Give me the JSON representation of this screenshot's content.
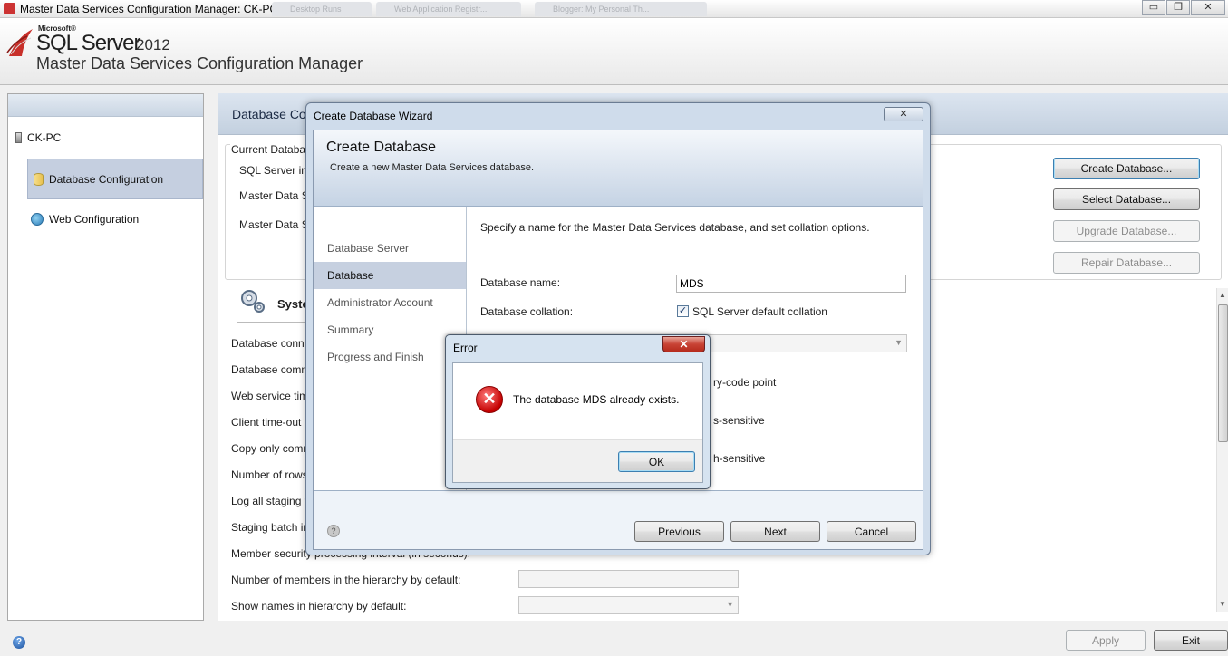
{
  "window": {
    "title": "Master Data Services Configuration Manager: CK-PC",
    "background_tabs": [
      "Desktop Runs",
      "Web Application Registr...",
      "Blogger: My Personal Th..."
    ],
    "controls": {
      "minimize": "▭",
      "restore": "❐",
      "close": "✕"
    }
  },
  "banner": {
    "microsoft": "Microsoft®",
    "sql_server": "SQL Server",
    "year": "2012",
    "product": "Master Data Services Configuration Manager"
  },
  "sidebar": {
    "server": "CK-PC",
    "items": [
      {
        "label": "Database Configuration",
        "icon": "database-icon",
        "selected": true
      },
      {
        "label": "Web Configuration",
        "icon": "globe-icon",
        "selected": false
      }
    ]
  },
  "main": {
    "header_title": "Database Configuration",
    "group_label": "Current Database",
    "group_rows": [
      "SQL Server instance:",
      "Master Data Services database:",
      "Master Data Services version:"
    ],
    "buttons": {
      "create": "Create Database...",
      "select": "Select Database...",
      "upgrade": "Upgrade Database...",
      "repair": "Repair Database..."
    },
    "system_settings_title": "System Settings",
    "settings_rows": [
      "Database connection time-out (in seconds):",
      "Database command time-out (in seconds):",
      "Web service time-out (in seconds):",
      "Client time-out (in seconds):",
      "Copy only committed versions:",
      "Number of rows per batch:",
      "Log all staging transactions:",
      "Staging batch interval (in seconds):",
      "Member security processing interval (in seconds):",
      "Number of members in the hierarchy by default:",
      "Show names in hierarchy by default:"
    ],
    "apply": "Apply",
    "exit": "Exit"
  },
  "wizard": {
    "title": "Create Database Wizard",
    "close": "✕",
    "heading": "Create Database",
    "subheading": "Create a new Master Data Services database.",
    "steps": [
      "Database Server",
      "Database",
      "Administrator Account",
      "Summary",
      "Progress and Finish"
    ],
    "active_step": "Database",
    "intro": "Specify a name for the Master Data Services database, and set collation options.",
    "db_name_label": "Database name:",
    "db_name_value": "MDS",
    "collation_label": "Database collation:",
    "default_collation_label": "SQL Server default collation",
    "default_collation_checked": true,
    "collation_option_fragments": [
      "ry-code point",
      "s-sensitive",
      "h-sensitive"
    ],
    "buttons": {
      "previous": "Previous",
      "next": "Next",
      "cancel": "Cancel"
    }
  },
  "error_dialog": {
    "title": "Error",
    "close": "✕",
    "message": "The database MDS already exists.",
    "ok": "OK"
  },
  "colors": {
    "accent_header": "#c5d3e4",
    "selected_nav": "#c5cfe0",
    "error_red": "#c40000"
  }
}
